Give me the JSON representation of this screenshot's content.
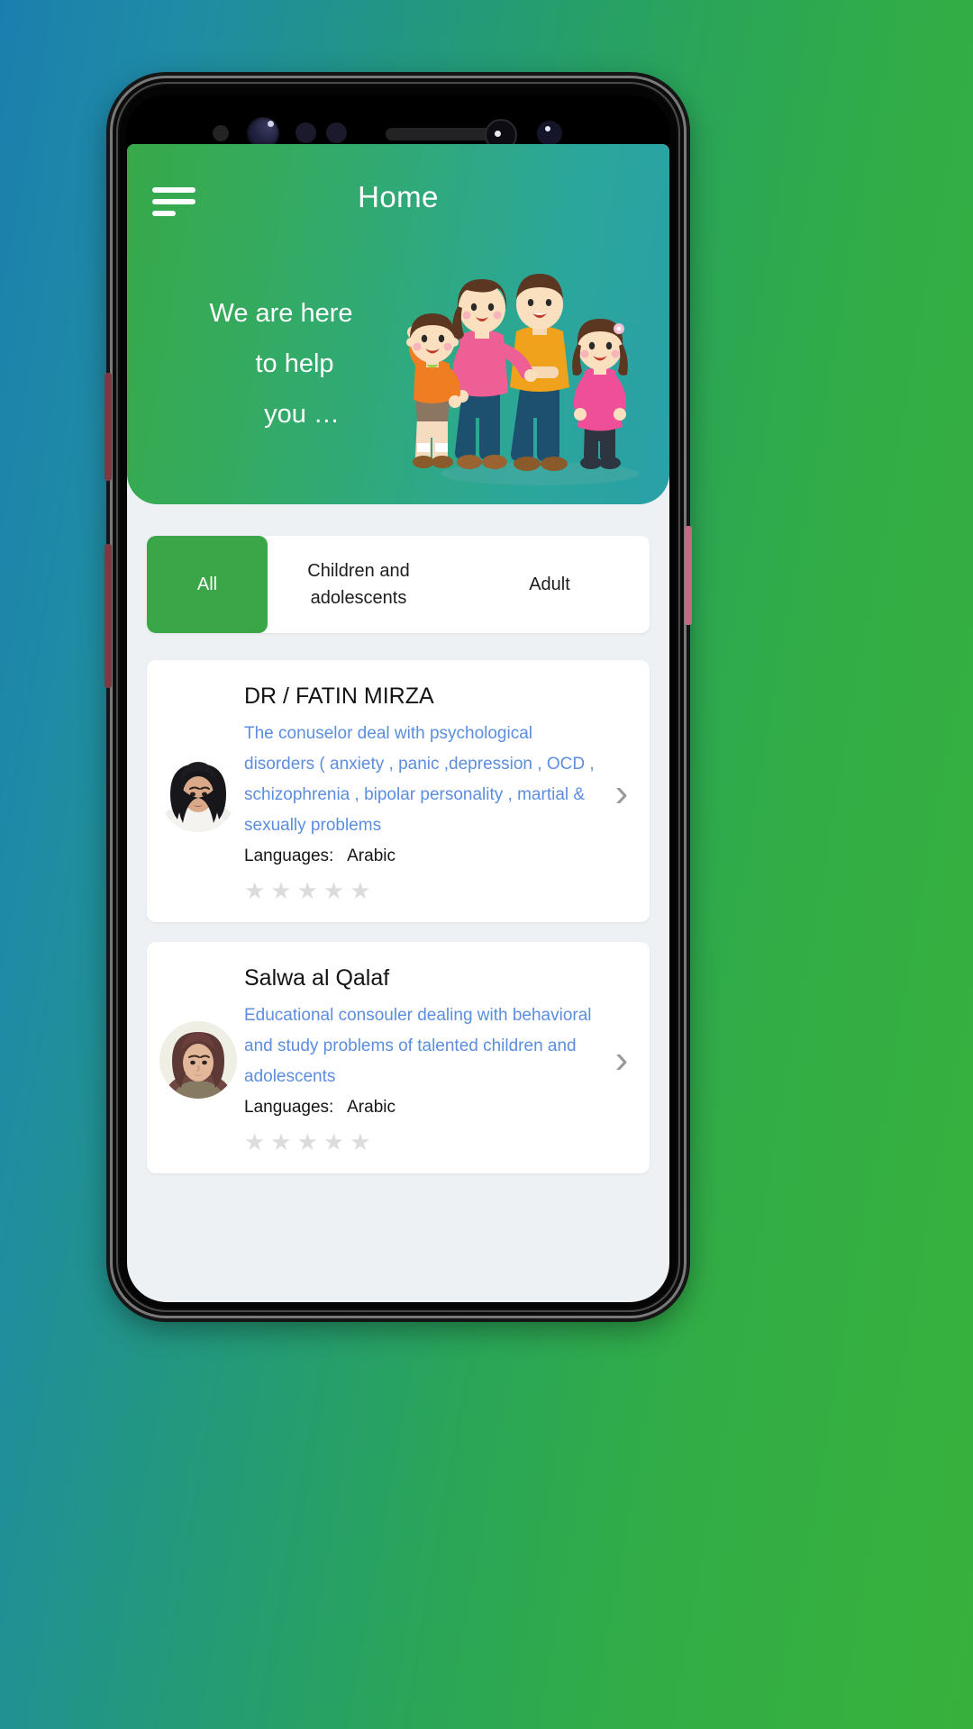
{
  "app": {
    "header": {
      "title": "Home",
      "menu_icon": "hamburger-menu-icon"
    },
    "hero": {
      "tagline_line1": "We are here",
      "tagline_line2": "to help",
      "tagline_line3": "you …",
      "illustration": "family-illustration",
      "gradient_from": "#37a94a",
      "gradient_to": "#2aa0a8"
    },
    "tabs": [
      {
        "label": "All",
        "active": true
      },
      {
        "label": "Children and adolescents",
        "active": false
      },
      {
        "label": "Adult",
        "active": false
      }
    ],
    "active_tab_color": "#3aa648",
    "providers": [
      {
        "name": "DR / FATIN MIRZA",
        "description": "The conuselor  deal with psychological disorders ( anxiety , panic ,depression , OCD , schizophrenia , bipolar personality , martial & sexually problems",
        "languages_label": "Languages:",
        "languages_value": "Arabic",
        "rating": 0,
        "rating_max": 5,
        "avatar": "avatar-fatin-mirza",
        "chevron": "chevron-right-icon"
      },
      {
        "name": "Salwa al Qalaf",
        "description": "Educational consouler dealing with behavioral and study problems of talented children and adolescents",
        "languages_label": "Languages:",
        "languages_value": "Arabic",
        "rating": 0,
        "rating_max": 5,
        "avatar": "avatar-salwa-al-qalaf",
        "chevron": "chevron-right-icon"
      }
    ],
    "description_text_color": "#5b8ede",
    "star_empty_color": "#dcdcdc",
    "star_glyph": "★",
    "chevron_glyph": "›",
    "background_gradient_from": "#1b7fae",
    "background_gradient_to": "#38b13c"
  }
}
